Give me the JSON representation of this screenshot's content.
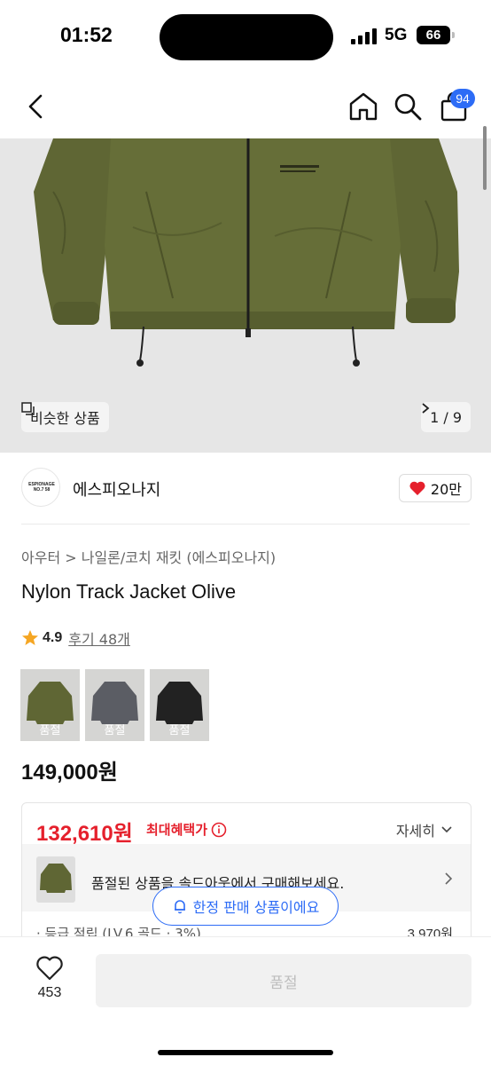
{
  "status_bar": {
    "time": "01:52",
    "network": "5G",
    "battery": "66"
  },
  "nav": {
    "cart_count": "94",
    "icons": [
      "back-icon",
      "home-icon",
      "search-icon",
      "cart-icon"
    ]
  },
  "gallery": {
    "similar_label": "비슷한 상품",
    "pager": "1 / 9",
    "image_background": "#e6e6e6",
    "jacket_color": "#5f6634"
  },
  "brand": {
    "logo_text": "ESPIONAGE NO.7 58",
    "name": "에스피오나지",
    "likes": "20만"
  },
  "product": {
    "breadcrumb": "아우터 > 나일론/코치 재킷 (에스피오나지)",
    "title": "Nylon Track Jacket Olive",
    "rating": "4.9",
    "reviews": "후기 48개",
    "options": [
      {
        "color": "#5f6634",
        "label": "품절"
      },
      {
        "color": "#5b5d64",
        "label": "품절"
      },
      {
        "color": "#222222",
        "label": "품절"
      }
    ],
    "price": "149,000원"
  },
  "benefit": {
    "price": "132,610원",
    "max_label": "최대혜택가",
    "detail_label": "자세히",
    "soldout_message": "품절된 상품을 솔드아웃에서 구매해보세요.",
    "points_label": "· 등급 적립 (LV.6 골드 · 3%)",
    "points_value": "3,970원",
    "accent_color": "#e5202c"
  },
  "limited_notice": "한정 판매 상품이에요",
  "bottom": {
    "wish_count": "453",
    "buy_label": "품절"
  }
}
